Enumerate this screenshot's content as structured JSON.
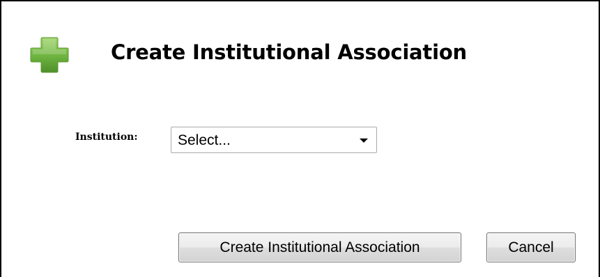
{
  "dialog": {
    "title": "Create Institutional Association",
    "icon": "plus-icon",
    "icon_color": "#6db33f"
  },
  "form": {
    "institution_label": "Institution:",
    "institution_select": {
      "selected": "Select..."
    }
  },
  "buttons": {
    "create_label": "Create Institutional Association",
    "cancel_label": "Cancel"
  }
}
